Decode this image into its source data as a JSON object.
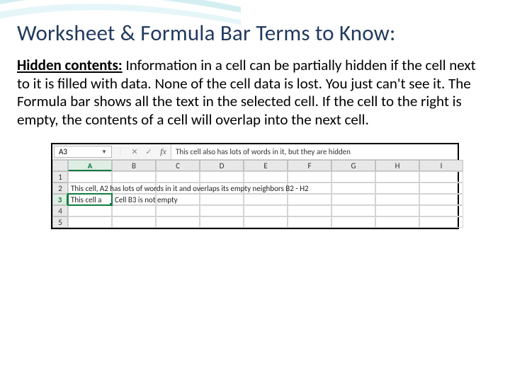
{
  "title": "Worksheet & Formula Bar Terms to Know:",
  "term": "Hidden contents:",
  "definition": " Information in a cell can be partially hidden if the cell next to it is filled with data. None of the cell data is lost. You just can't see it. The Formula bar shows all the text in the selected cell. If the cell to the right is empty, the contents of a cell will overlap into the next cell.",
  "excel": {
    "name_box": "A3",
    "cancel_glyph": "✕",
    "enter_glyph": "✓",
    "fx_label": "fx",
    "formula_value": "This cell also has lots of words in it, but they are hidden",
    "cols": [
      "A",
      "B",
      "C",
      "D",
      "E",
      "F",
      "G",
      "H",
      "I"
    ],
    "rows": [
      "1",
      "2",
      "3",
      "4",
      "5"
    ],
    "a2_text": "This cell, A2 has lots of words in it and overlaps its empty neighbors B2 - H2",
    "a3_text": "This cell a",
    "b3_text": "Cell B3 is not empty"
  }
}
